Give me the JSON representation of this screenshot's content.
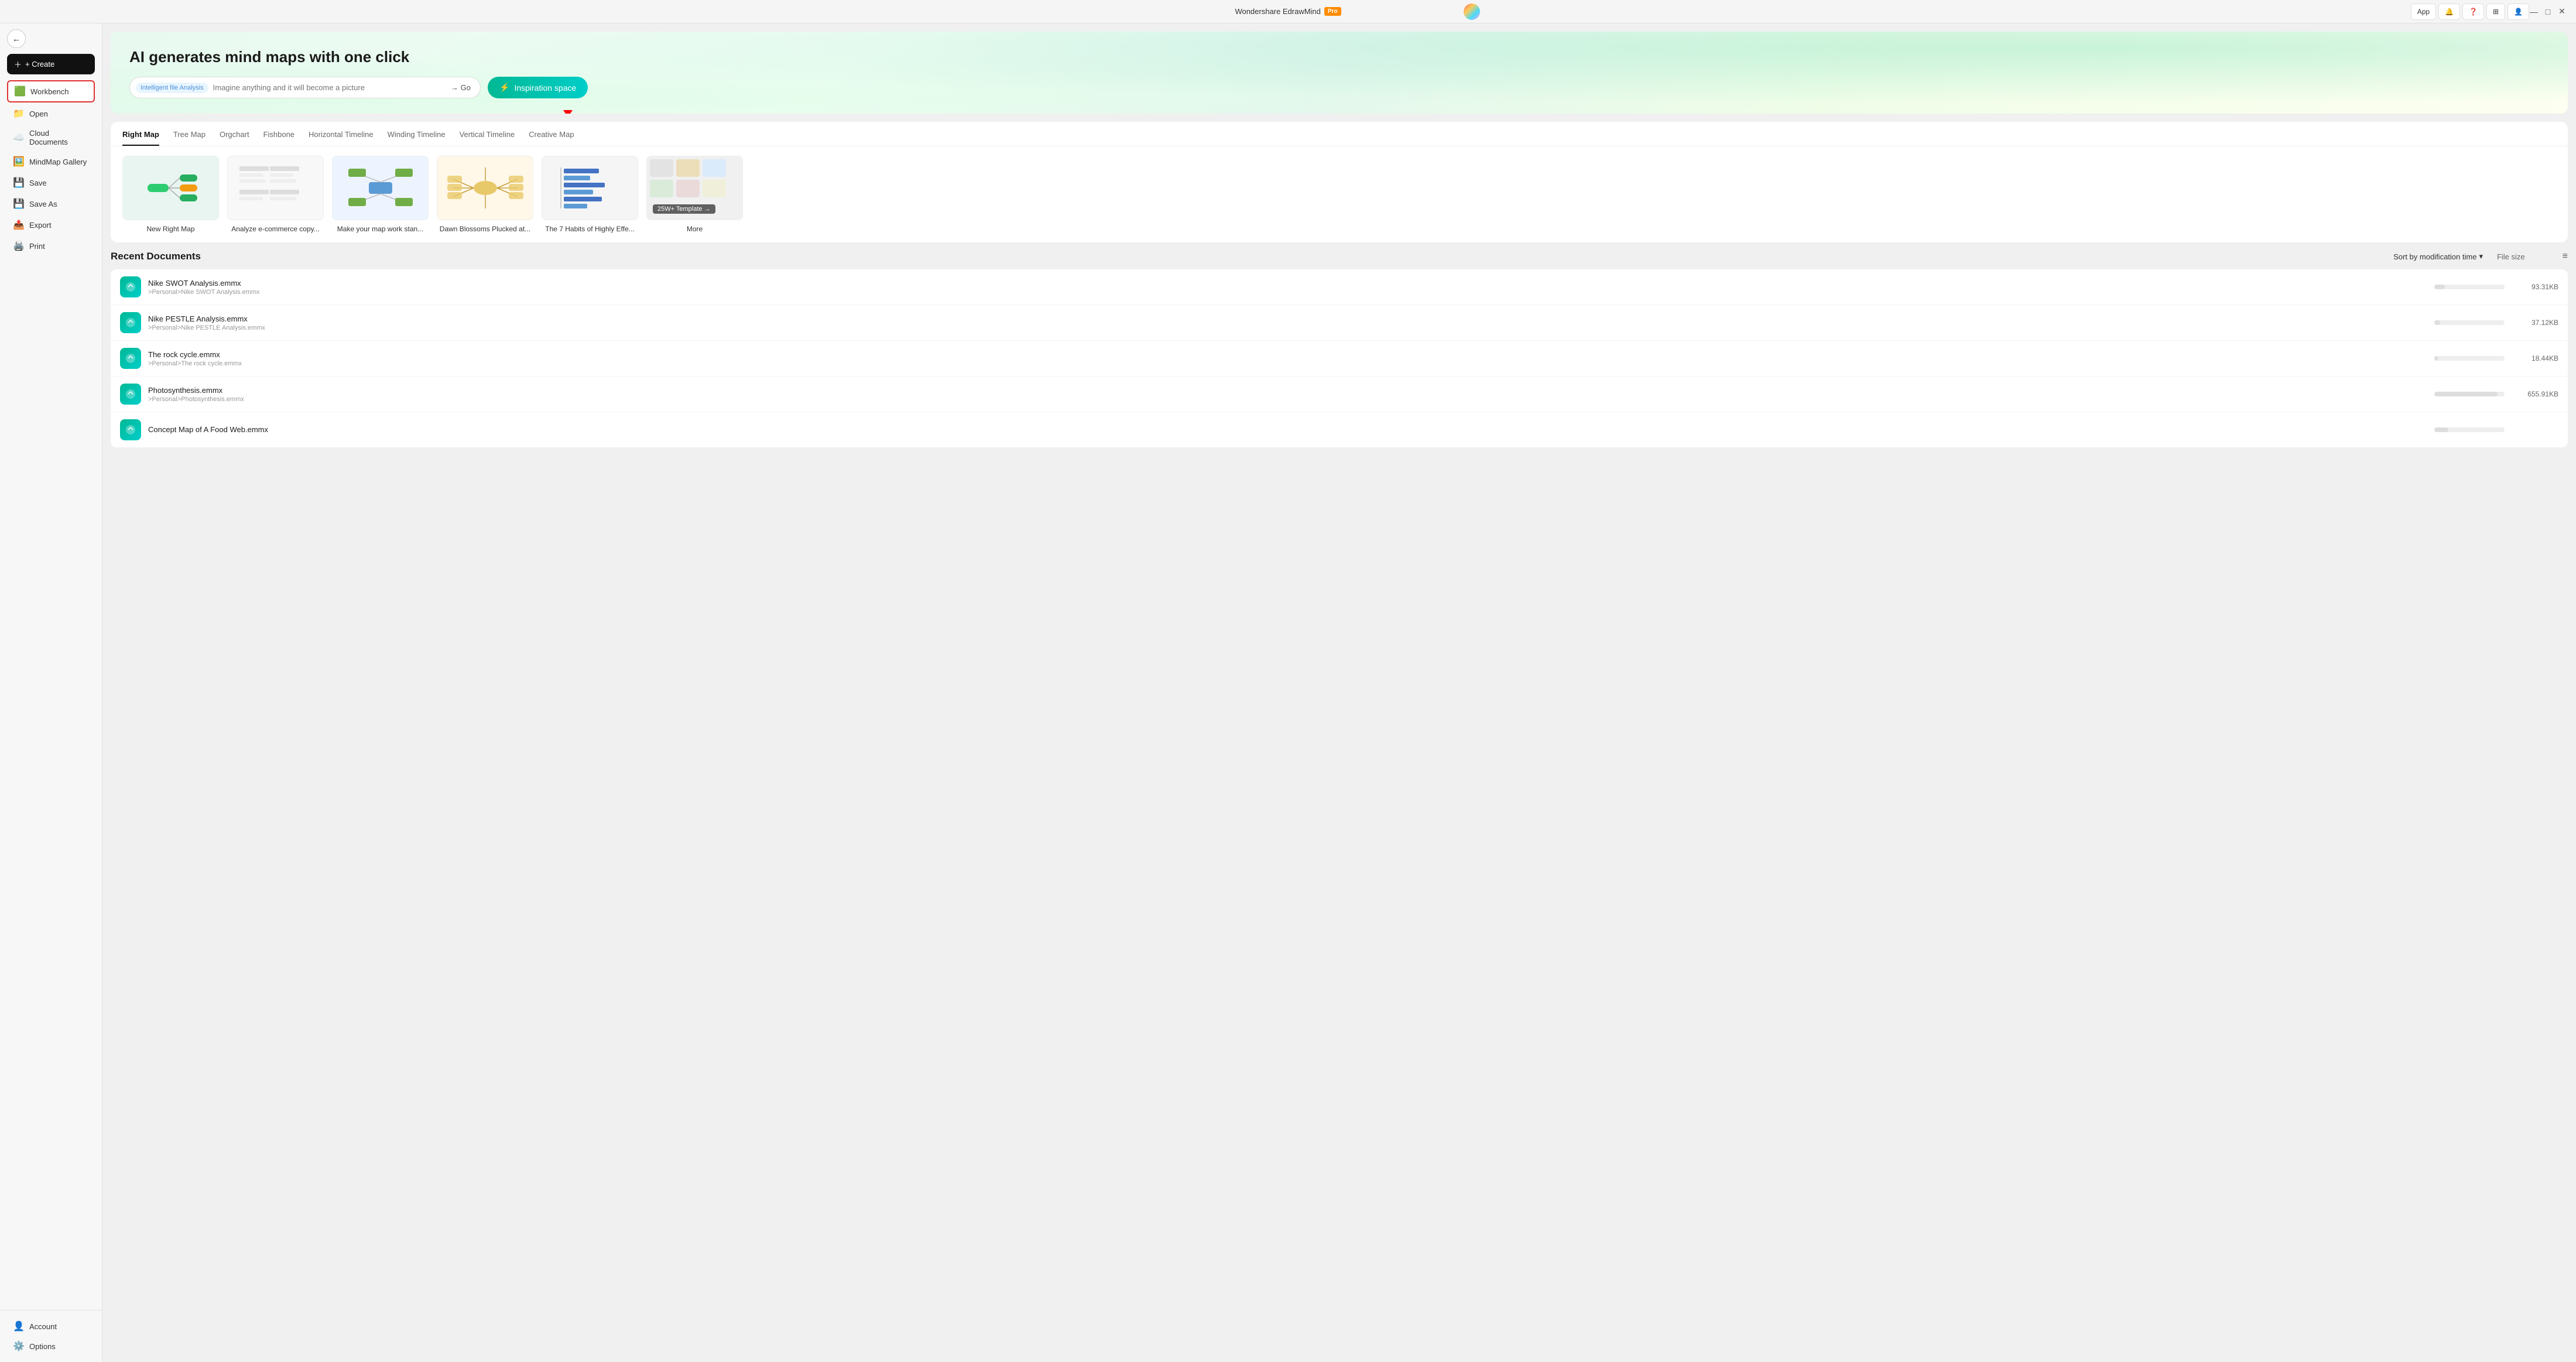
{
  "titlebar": {
    "title": "Wondershare EdrawMind",
    "pro_label": "Pro",
    "min_btn": "—",
    "max_btn": "□",
    "close_btn": "✕",
    "app_btn": "App",
    "actions": [
      "App",
      "🔔",
      "❓",
      "⊞",
      "👤"
    ]
  },
  "sidebar": {
    "back_label": "←",
    "create_label": "+ Create",
    "items": [
      {
        "id": "workbench",
        "label": "Workbench",
        "icon": "🟩",
        "active": true
      },
      {
        "id": "open",
        "label": "Open",
        "icon": "📁"
      },
      {
        "id": "cloud",
        "label": "Cloud Documents",
        "icon": "☁️"
      },
      {
        "id": "gallery",
        "label": "MindMap Gallery",
        "icon": "🖼️"
      },
      {
        "id": "save",
        "label": "Save",
        "icon": "💾"
      },
      {
        "id": "saveas",
        "label": "Save As",
        "icon": "💾"
      },
      {
        "id": "export",
        "label": "Export",
        "icon": "📤"
      },
      {
        "id": "print",
        "label": "Print",
        "icon": "🖨️"
      }
    ],
    "bottom_items": [
      {
        "id": "account",
        "label": "Account",
        "icon": "👤"
      },
      {
        "id": "options",
        "label": "Options",
        "icon": "⚙️"
      }
    ]
  },
  "hero": {
    "title": "AI generates mind maps with one click",
    "analysis_tag": "Intelligent file Analysis",
    "input_placeholder": "Imagine anything and it will become a picture",
    "go_label": "→ Go",
    "inspiration_label": "Inspiration space",
    "inspiration_icon": "⚡"
  },
  "templates": {
    "tabs": [
      {
        "id": "rightmap",
        "label": "Right Map",
        "active": true
      },
      {
        "id": "treemap",
        "label": "Tree Map"
      },
      {
        "id": "orgchart",
        "label": "Orgchart"
      },
      {
        "id": "fishbone",
        "label": "Fishbone"
      },
      {
        "id": "htimeline",
        "label": "Horizontal Timeline"
      },
      {
        "id": "wtimeline",
        "label": "Winding Timeline"
      },
      {
        "id": "vtimeline",
        "label": "Vertical Timeline"
      },
      {
        "id": "creativemap",
        "label": "Creative Map"
      }
    ],
    "cards": [
      {
        "id": "new-right-map",
        "label": "New Right Map",
        "bg": "rightmap"
      },
      {
        "id": "ecommerce",
        "label": "Analyze e-commerce copy...",
        "bg": "ecommerce"
      },
      {
        "id": "work-stand",
        "label": "Make your map work stan...",
        "bg": "work"
      },
      {
        "id": "dawn-blossoms",
        "label": "Dawn Blossoms Plucked at...",
        "bg": "dawn"
      },
      {
        "id": "habits",
        "label": "The 7 Habits of Highly Effe...",
        "bg": "habits"
      },
      {
        "id": "more",
        "label": "More",
        "count": "25W+ Template →",
        "bg": "more"
      }
    ]
  },
  "recent": {
    "title": "Recent Documents",
    "sort_label": "Sort by modification time",
    "file_size_label": "File size",
    "docs": [
      {
        "id": "nike-swot",
        "name": "Nike SWOT Analysis.emmx",
        "path": ">Personal>Nike SWOT Analysis.emmx",
        "size": "93.31KB",
        "bar_pct": 15
      },
      {
        "id": "nike-pestle",
        "name": "Nike PESTLE Analysis.emmx",
        "path": ">Personal>Nike PESTLE Analysis.emmx",
        "size": "37.12KB",
        "bar_pct": 8
      },
      {
        "id": "rock-cycle",
        "name": "The rock cycle.emmx",
        "path": ">Personal>The rock cycle.emmx",
        "size": "18.44KB",
        "bar_pct": 5
      },
      {
        "id": "photosynthesis",
        "name": "Photosynthesis.emmx",
        "path": ">Personal>Photosynthesis.emmx",
        "size": "655.91KB",
        "bar_pct": 90
      },
      {
        "id": "food-web",
        "name": "Concept Map of A Food Web.emmx",
        "path": "",
        "size": "",
        "bar_pct": 20
      }
    ]
  }
}
